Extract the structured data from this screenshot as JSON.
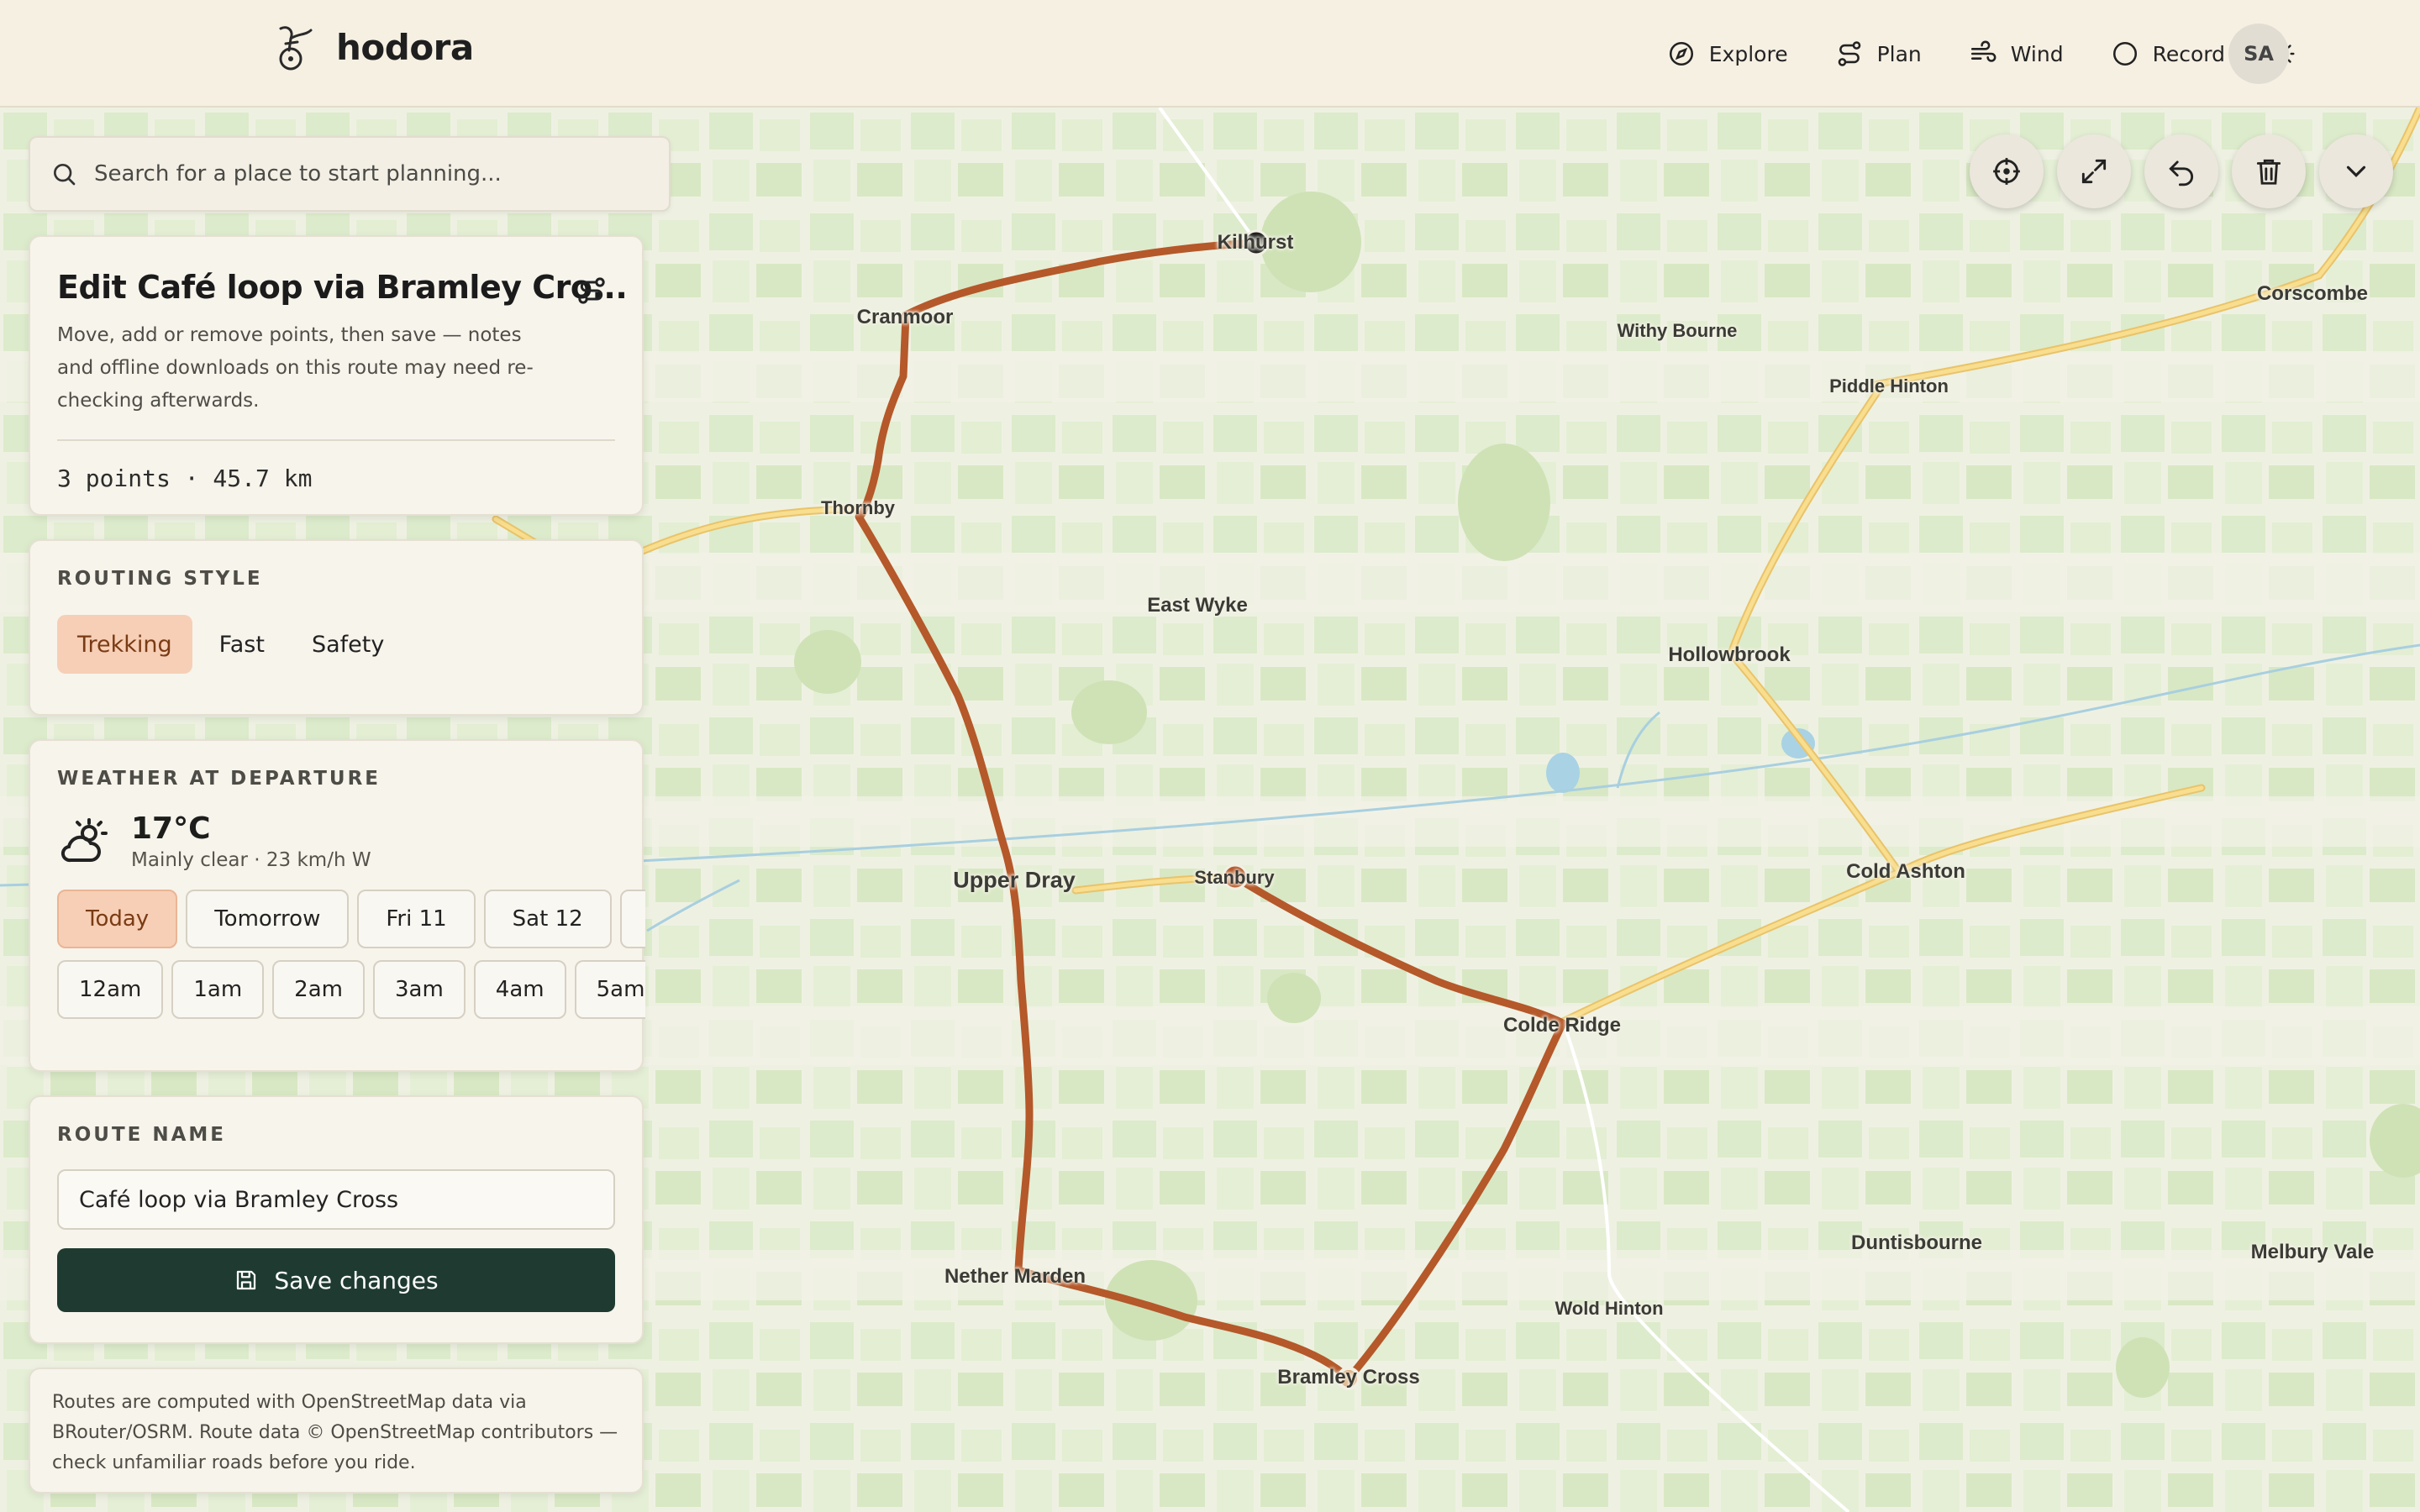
{
  "app": {
    "name": "hodora"
  },
  "nav": {
    "items": [
      {
        "label": "Explore",
        "icon": "compass-icon"
      },
      {
        "label": "Plan",
        "icon": "route-icon"
      },
      {
        "label": "Wind",
        "icon": "wind-icon"
      },
      {
        "label": "Record",
        "icon": "record-icon"
      }
    ],
    "theme_icon": "sun-icon",
    "avatar": "SA"
  },
  "search": {
    "placeholder": "Search for a place to start planning..."
  },
  "edit": {
    "title": "Edit Café loop via Bramley Cro...",
    "description": "Move, add or remove points, then save — notes and offline downloads on this route may need re-checking afterwards.",
    "stats": "3 points · 45.7 km"
  },
  "routing": {
    "label": "ROUTING STYLE",
    "options": [
      "Trekking",
      "Fast",
      "Safety"
    ],
    "selected": "Trekking"
  },
  "weather": {
    "label": "WEATHER AT DEPARTURE",
    "temperature": "17°C",
    "summary": "Mainly clear · 23 km/h W",
    "icon": "partly-cloudy-icon",
    "days": [
      "Today",
      "Tomorrow",
      "Fri 11",
      "Sat 12"
    ],
    "selected_day": "Today",
    "hours": [
      "12am",
      "1am",
      "2am",
      "3am",
      "4am",
      "5am"
    ]
  },
  "route_name": {
    "label": "ROUTE NAME",
    "value": "Café loop via Bramley Cross",
    "save_label": "Save changes"
  },
  "attribution": "Routes are computed with OpenStreetMap data via BRouter/OSRM. Route data © OpenStreetMap contributors — check unfamiliar roads before you ride.",
  "map": {
    "places": [
      "Kilhurst",
      "Cranmoor",
      "Thornby",
      "East Wyke",
      "Withy Bourne",
      "Piddle Hinton",
      "Corscombe",
      "Hollowbrook",
      "Cold Ashton",
      "Upper Dray",
      "Stanbury",
      "Colde Ridge",
      "Duntisbourne",
      "Melbury Vale",
      "Nether Marden",
      "Wold Hinton",
      "Bramley Cross"
    ],
    "tools": [
      "locate-icon",
      "fit-icon",
      "undo-icon",
      "delete-icon",
      "chevron-down-icon"
    ],
    "colors": {
      "route": "#b5582a",
      "road": "#f4cf74",
      "river": "#a8cfe0",
      "land": "#eef1e2",
      "woods": "#d9e8c6"
    }
  }
}
